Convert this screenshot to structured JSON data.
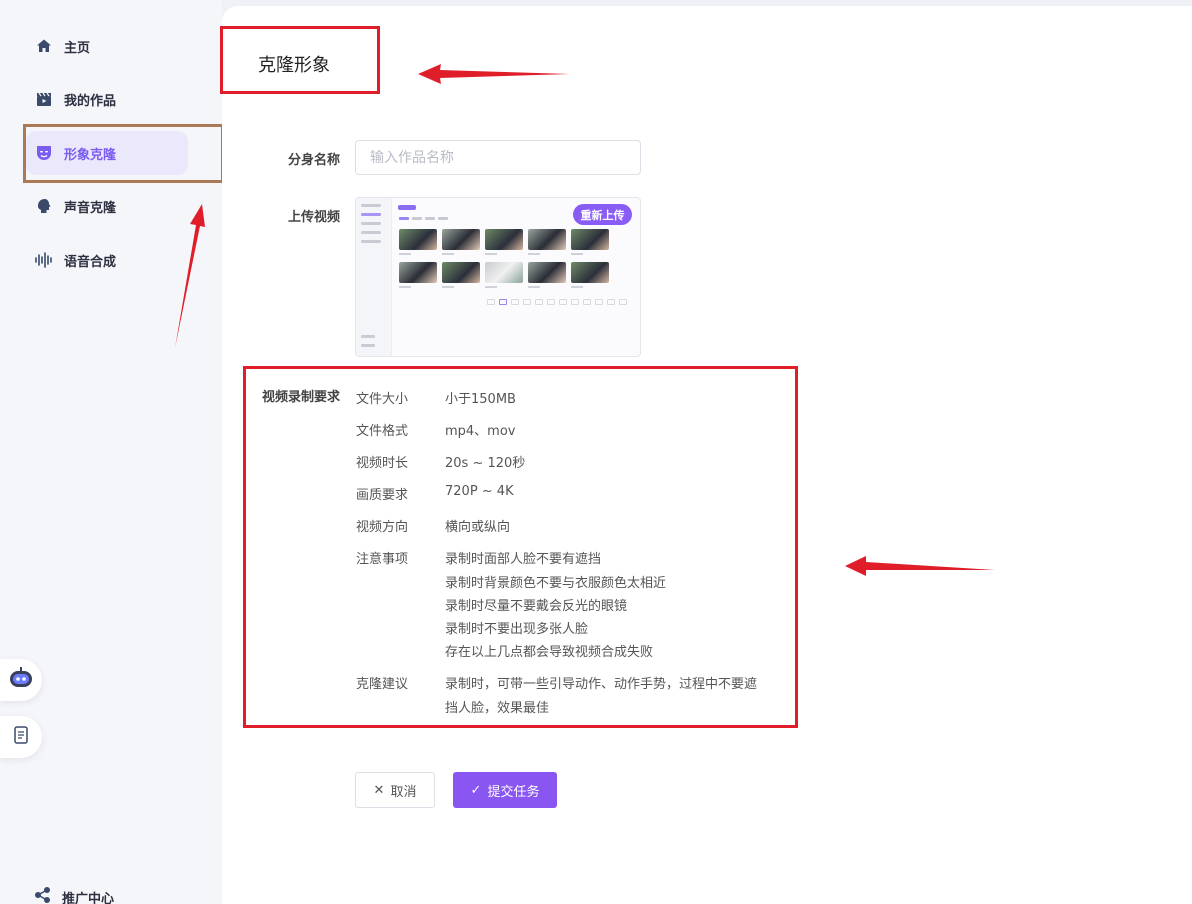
{
  "sidebar": {
    "items": [
      {
        "label": "主页",
        "icon": "home-icon"
      },
      {
        "label": "我的作品",
        "icon": "clapperboard-icon"
      },
      {
        "label": "形象克隆",
        "icon": "mask-icon",
        "active": true
      },
      {
        "label": "声音克隆",
        "icon": "voice-head-icon"
      },
      {
        "label": "语音合成",
        "icon": "waveform-icon"
      }
    ],
    "promo_label": "推广中心",
    "float_buttons": [
      "robot-assistant-icon",
      "document-icon"
    ]
  },
  "page": {
    "title": "克隆形象"
  },
  "form": {
    "name_label": "分身名称",
    "name_placeholder": "输入作品名称",
    "name_value": "",
    "upload_label": "上传视频",
    "reupload_label": "重新上传"
  },
  "requirements": {
    "heading": "视频录制要求",
    "rows": [
      {
        "key": "文件大小",
        "value": [
          "小于150MB"
        ]
      },
      {
        "key": "文件格式",
        "value": [
          "mp4、mov"
        ]
      },
      {
        "key": "视频时长",
        "value": [
          "20s ~ 120秒"
        ]
      },
      {
        "key": "画质要求",
        "value": [
          "720P ~ 4K"
        ]
      },
      {
        "key": "视频方向",
        "value": [
          "横向或纵向"
        ]
      },
      {
        "key": "注意事项",
        "value": [
          "录制时面部人脸不要有遮挡",
          "录制时背景颜色不要与衣服颜色太相近",
          "录制时尽量不要戴会反光的眼镜",
          "录制时不要出现多张人脸",
          "存在以上几点都会导致视频合成失败"
        ]
      },
      {
        "key": "克隆建议",
        "value": [
          "录制时，可带一些引导动作、动作手势，过程中不要遮",
          "挡人脸，效果最佳"
        ]
      }
    ]
  },
  "actions": {
    "cancel_label": "取消",
    "submit_label": "提交任务"
  },
  "colors": {
    "accent": "#8a56f2",
    "annotation_red": "#e01e2a",
    "annotation_brown": "#a97a55"
  }
}
